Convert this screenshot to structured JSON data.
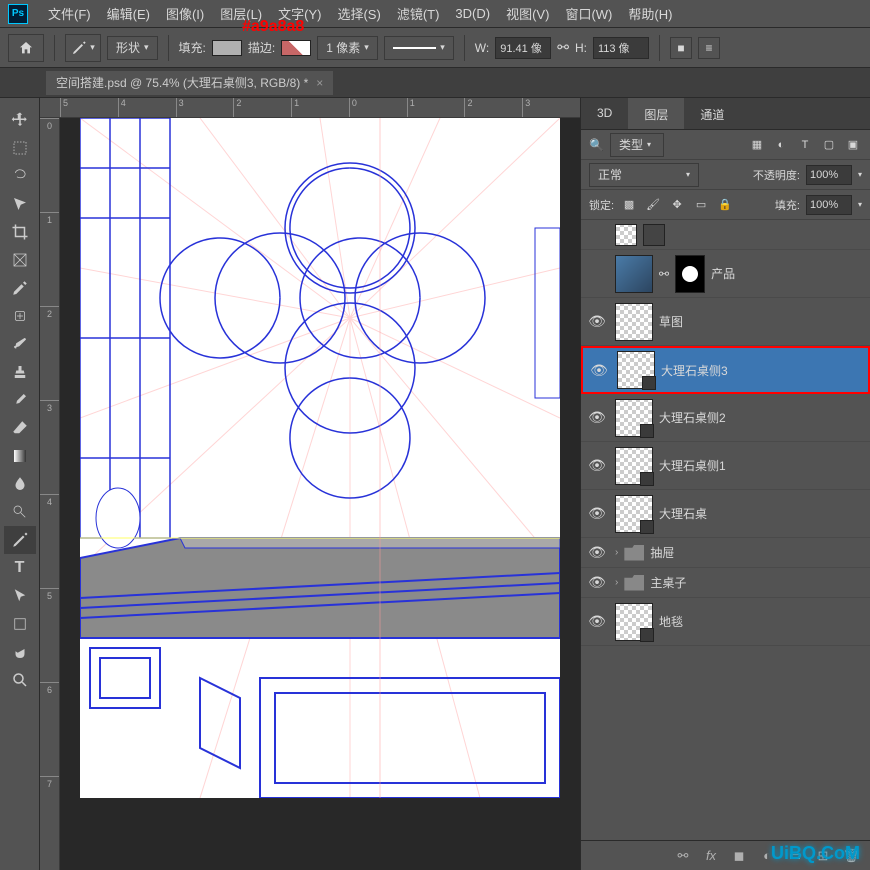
{
  "annotation": "#a9a8a8",
  "menubar": {
    "items": [
      "文件(F)",
      "编辑(E)",
      "图像(I)",
      "图层(L)",
      "文字(Y)",
      "选择(S)",
      "滤镜(T)",
      "3D(D)",
      "视图(V)",
      "窗口(W)",
      "帮助(H)"
    ]
  },
  "optbar": {
    "mode": "形状",
    "fill_label": "填充:",
    "stroke_label": "描边:",
    "stroke_width": "1 像素",
    "width_label": "W:",
    "width_value": "91.41 像",
    "height_label": "H:",
    "height_value": "113 像"
  },
  "tab": {
    "title": "空间搭建.psd @ 75.4% (大理石桌侧3, RGB/8) *"
  },
  "ruler_h": [
    "5",
    "4",
    "3",
    "2",
    "1",
    "0",
    "1",
    "2",
    "3"
  ],
  "ruler_v": [
    "0",
    "1",
    "2",
    "3",
    "4",
    "5",
    "6",
    "7"
  ],
  "panels": {
    "tabs": [
      "3D",
      "图层",
      "通道"
    ],
    "active_tab": 1,
    "filter_label": "类型",
    "blend_mode": "正常",
    "opacity_label": "不透明度:",
    "opacity_value": "100%",
    "lock_label": "锁定:",
    "fill_label": "填充:",
    "fill_value": "100%"
  },
  "layers": [
    {
      "visible": false,
      "thumb": "small",
      "name": "",
      "kind": "small"
    },
    {
      "visible": false,
      "thumb": "image",
      "mask": true,
      "name": "产品",
      "kind": "normal"
    },
    {
      "visible": true,
      "thumb": "checker",
      "name": "草图",
      "kind": "normal"
    },
    {
      "visible": true,
      "thumb": "shape",
      "name": "大理石桌侧3",
      "kind": "normal",
      "selected": true
    },
    {
      "visible": true,
      "thumb": "shape",
      "name": "大理石桌侧2",
      "kind": "normal"
    },
    {
      "visible": true,
      "thumb": "shape",
      "name": "大理石桌侧1",
      "kind": "normal"
    },
    {
      "visible": true,
      "thumb": "shape",
      "name": "大理石桌",
      "kind": "normal"
    },
    {
      "visible": true,
      "thumb": "folder",
      "name": "抽屉",
      "kind": "folder"
    },
    {
      "visible": true,
      "thumb": "folder",
      "name": "主桌子",
      "kind": "folder"
    },
    {
      "visible": true,
      "thumb": "shape",
      "name": "地毯",
      "kind": "normal"
    }
  ],
  "watermark": {
    "main": "UiBQ.CoM"
  }
}
